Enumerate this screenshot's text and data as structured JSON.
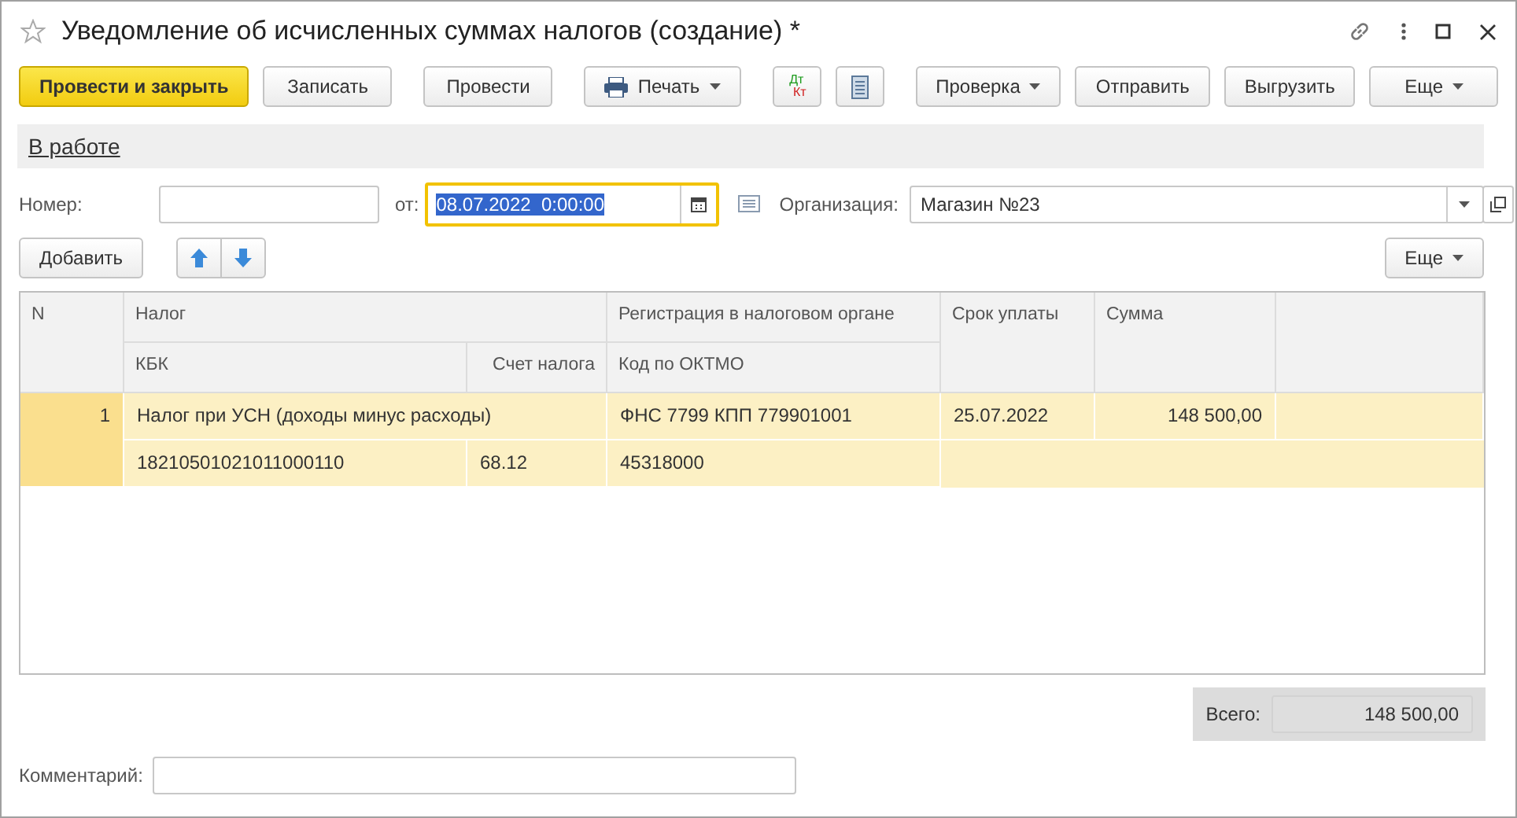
{
  "window": {
    "title": "Уведомление об исчисленных суммах налогов (создание) *",
    "favorite": false
  },
  "toolbar": [
    [
      {
        "kind": "default",
        "label": "Провести и закрыть"
      },
      {
        "kind": "button",
        "label": "Записать"
      }
    ],
    [
      {
        "kind": "button",
        "label": "Провести"
      }
    ],
    [
      {
        "kind": "print",
        "label": "Печать"
      }
    ],
    [
      {
        "kind": "dtkt",
        "top": "Дт",
        "bottom": "Кт"
      },
      {
        "kind": "list"
      }
    ],
    [
      {
        "kind": "menu",
        "label": "Проверка"
      },
      {
        "kind": "button",
        "label": "Отправить"
      },
      {
        "kind": "button",
        "label": "Выгрузить"
      },
      {
        "kind": "menu",
        "label": "Еще"
      }
    ]
  ],
  "status_link": "В работе",
  "fields": {
    "number": {
      "label": "Номер:"
    },
    "date": {
      "label": "от:",
      "value": "08.07.2022  0:00:00",
      "focused": true,
      "selected": true
    },
    "organization": {
      "label": "Организация:",
      "value": "Магазин №23"
    }
  },
  "table_toolbar": {
    "add": "Добавить",
    "more": "Еще"
  },
  "table": {
    "columns": {
      "n": "N",
      "tax": "Налог",
      "kbk": "КБК",
      "account": "Счет налога",
      "registration": "Регистрация в налоговом органе",
      "oktmo": "Код по ОКТМО",
      "due": "Срок уплаты",
      "sum": "Сумма"
    },
    "rows": [
      {
        "n": "1",
        "tax": "Налог при УСН (доходы минус расходы)",
        "kbk": "18210501021011000110",
        "account": "68.12",
        "registration": "ФНС 7799 КПП 779901001",
        "oktmo": "45318000",
        "due": "25.07.2022",
        "sum": "148 500,00",
        "selected": true
      }
    ]
  },
  "total": {
    "label": "Всего:",
    "value": "148 500,00"
  },
  "comment": {
    "label": "Комментарий:"
  }
}
